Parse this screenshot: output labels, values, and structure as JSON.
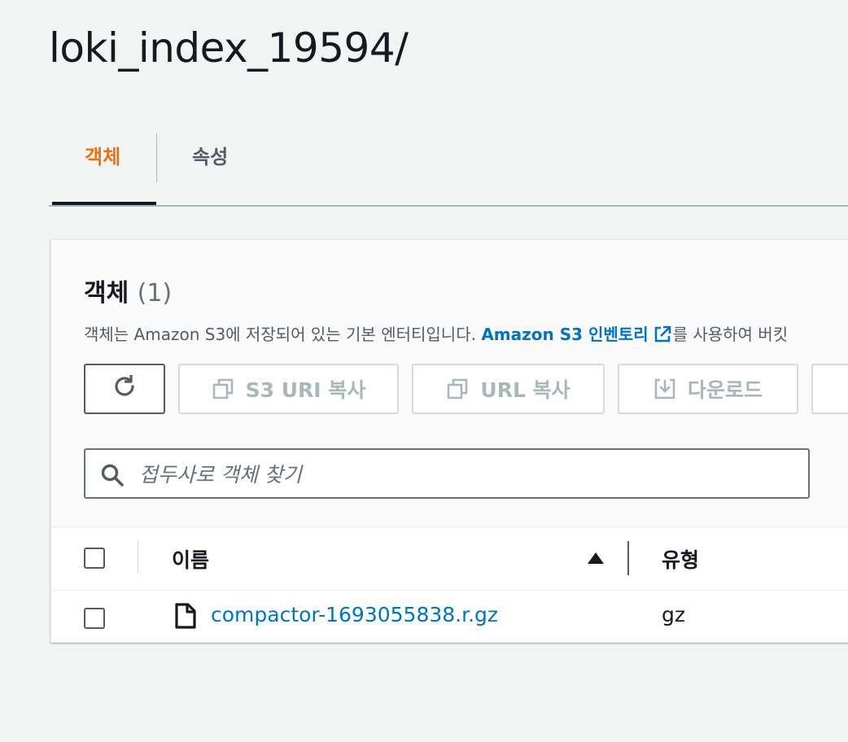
{
  "page": {
    "title": "loki_index_19594/"
  },
  "tabs": [
    {
      "label": "객체",
      "active": true
    },
    {
      "label": "속성",
      "active": false
    }
  ],
  "objects_panel": {
    "title": "객체",
    "count": "(1)",
    "description_prefix": "객체는 Amazon S3에 저장되어 있는 기본 엔터티입니다. ",
    "description_link": "Amazon S3 인벤토리",
    "description_suffix": "를 사용하여 버킷",
    "toolbar": {
      "copy_s3_uri": "S3 URI 복사",
      "copy_url": "URL 복사",
      "download": "다운로드"
    },
    "search": {
      "placeholder": "접두사로 객체 찾기",
      "value": ""
    },
    "table": {
      "columns": {
        "name": "이름",
        "type": "유형"
      },
      "sort": "ascending",
      "rows": [
        {
          "name": "compactor-1693055838.r.gz",
          "type": "gz"
        }
      ]
    }
  },
  "colors": {
    "active_tab": "#ec7211",
    "link": "#0073bb",
    "text": "#16191f",
    "disabled": "#aab7b8",
    "background": "#f2f3f3"
  },
  "icons": [
    "refresh-icon",
    "copy-icon",
    "download-icon",
    "search-icon",
    "external-link-icon",
    "sort-ascending-icon",
    "file-icon"
  ]
}
